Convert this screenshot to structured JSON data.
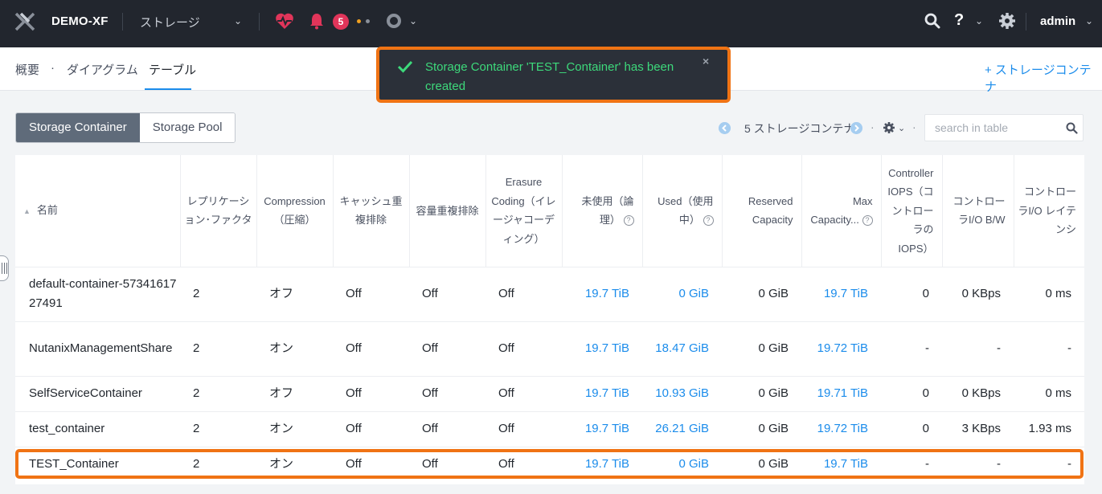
{
  "topbar": {
    "cluster_name": "DEMO-XF",
    "nav_current": "ストレージ",
    "alert_count": "5",
    "user": "admin",
    "help_glyph": "?",
    "caret": "⌄"
  },
  "subnav": {
    "items": [
      "概要",
      "ダイアグラム",
      "テーブル"
    ],
    "separator": "·",
    "add_action": "+ ストレージコンテナ"
  },
  "toast": {
    "message": "Storage Container 'TEST_Container' has been created",
    "close": "×"
  },
  "toolbar": {
    "tabs": [
      "Storage Container",
      "Storage Pool"
    ],
    "pager_text": "5 ストレージコンテナ",
    "search_placeholder": "search in table",
    "separator": "·",
    "caret": "⌄"
  },
  "table": {
    "columns": [
      "名前",
      "レプリケーション･ファクタ",
      "Compression（圧縮）",
      "キャッシュ重複排除",
      "容量重複排除",
      "Erasure Coding（イレージャコーディング）",
      "未使用（論理）",
      "Used（使用中）",
      "Reserved Capacity",
      "Max Capacity...",
      "Controller IOPS（コントローラのIOPS）",
      "コントローラI/O B/W",
      "コントローラI/O レイテンシ"
    ],
    "rows": [
      {
        "name": "default-container-5734161727491",
        "rf": "2",
        "compression": "オフ",
        "cache_dedup": "Off",
        "capacity_dedup": "Off",
        "erasure": "Off",
        "free": "19.7 TiB",
        "used": "0 GiB",
        "reserved": "0 GiB",
        "max": "19.7 TiB",
        "iops": "0",
        "bw": "0 KBps",
        "latency": "0 ms"
      },
      {
        "name": "NutanixManagementShare",
        "rf": "2",
        "compression": "オン",
        "cache_dedup": "Off",
        "capacity_dedup": "Off",
        "erasure": "Off",
        "free": "19.7 TiB",
        "used": "18.47 GiB",
        "reserved": "0 GiB",
        "max": "19.72 TiB",
        "iops": "-",
        "bw": "-",
        "latency": "-"
      },
      {
        "name": "SelfServiceContainer",
        "rf": "2",
        "compression": "オフ",
        "cache_dedup": "Off",
        "capacity_dedup": "Off",
        "erasure": "Off",
        "free": "19.7 TiB",
        "used": "10.93 GiB",
        "reserved": "0 GiB",
        "max": "19.71 TiB",
        "iops": "0",
        "bw": "0 KBps",
        "latency": "0 ms"
      },
      {
        "name": "test_container",
        "rf": "2",
        "compression": "オン",
        "cache_dedup": "Off",
        "capacity_dedup": "Off",
        "erasure": "Off",
        "free": "19.7 TiB",
        "used": "26.21 GiB",
        "reserved": "0 GiB",
        "max": "19.72 TiB",
        "iops": "0",
        "bw": "3 KBps",
        "latency": "1.93 ms"
      },
      {
        "name": "TEST_Container",
        "rf": "2",
        "compression": "オン",
        "cache_dedup": "Off",
        "capacity_dedup": "Off",
        "erasure": "Off",
        "free": "19.7 TiB",
        "used": "0 GiB",
        "reserved": "0 GiB",
        "max": "19.7 TiB",
        "iops": "-",
        "bw": "-",
        "latency": "-"
      }
    ]
  },
  "colors": {
    "accent": "#1b8ceb",
    "highlight": "#f07314",
    "success": "#3dd97b",
    "topbar_bg": "#22262e",
    "alert_red": "#e1355a"
  }
}
